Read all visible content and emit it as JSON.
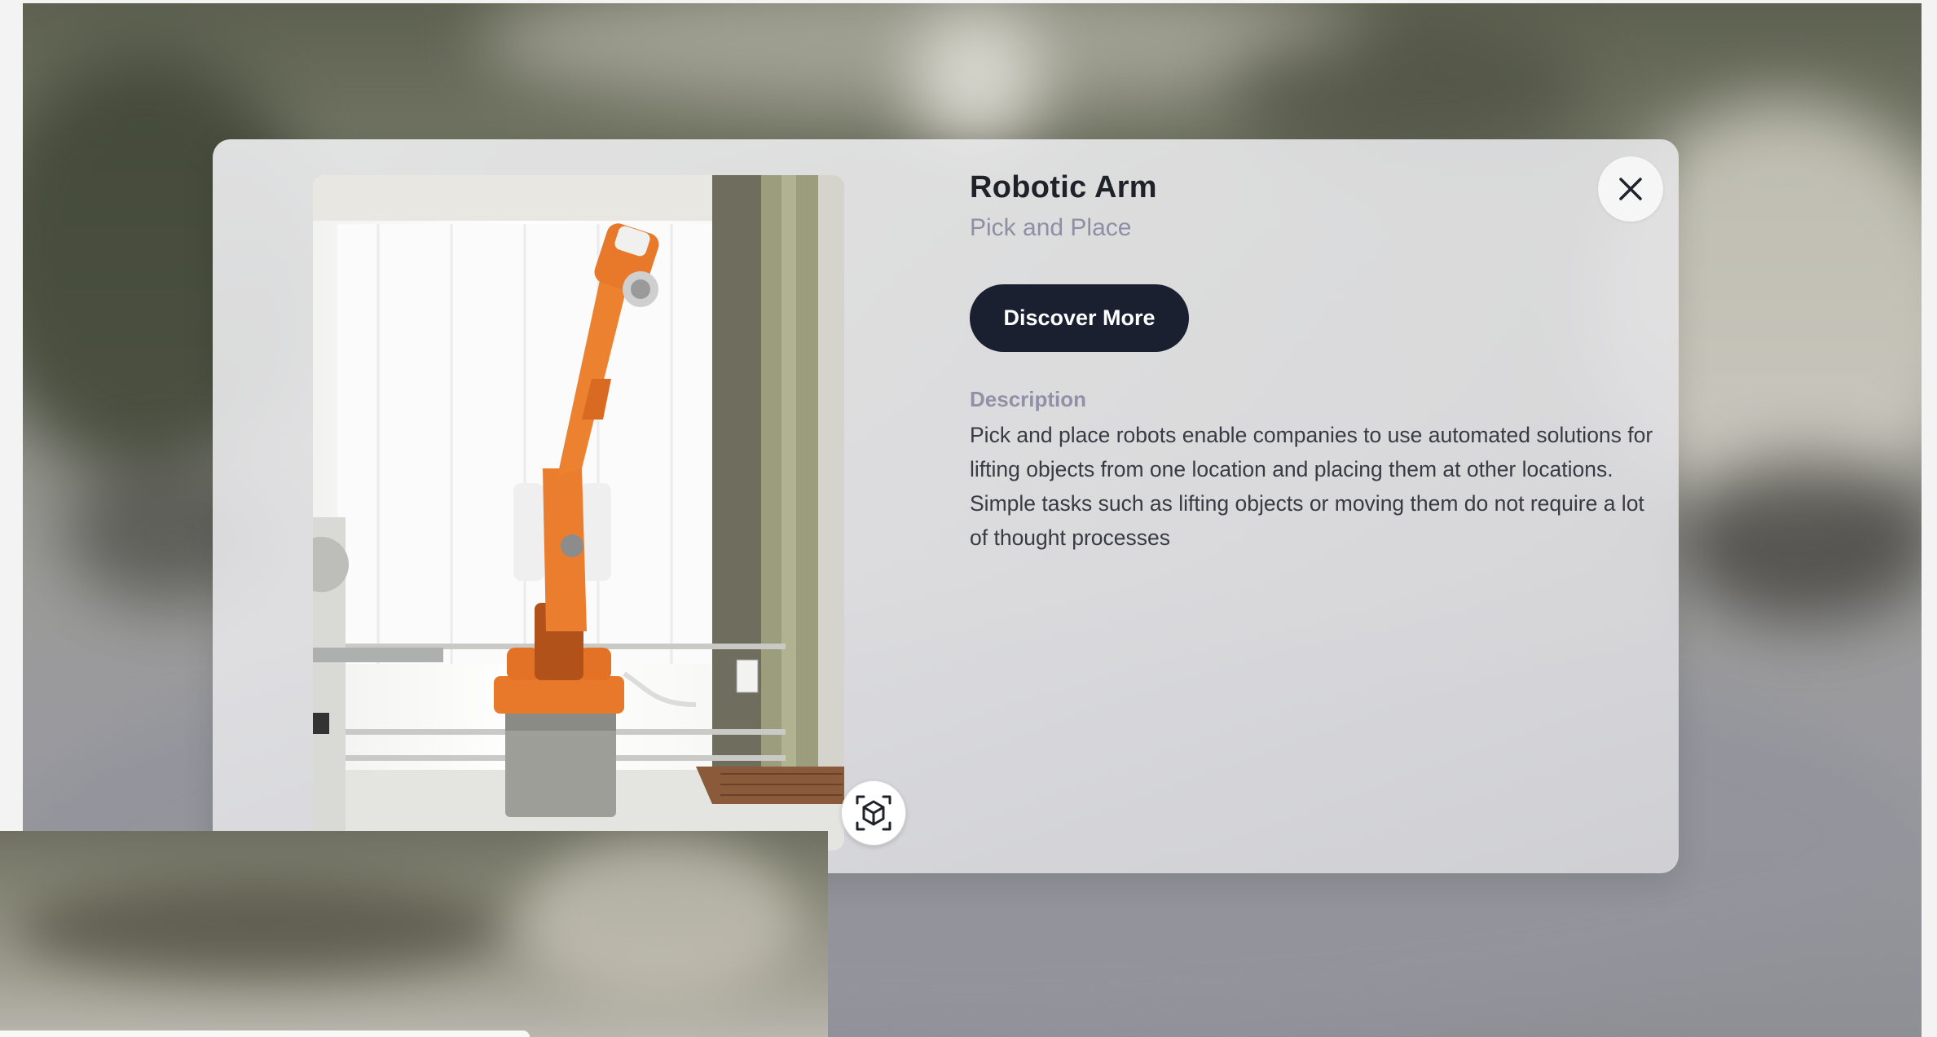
{
  "modal": {
    "title": "Robotic Arm",
    "subtitle": "Pick and Place",
    "cta_label": "Discover More",
    "description_label": "Description",
    "description": "Pick and place robots enable companies to use automated solutions for lifting objects from one location and placing them at other locations. Simple tasks such as lifting objects or moving them do not require a lot of thought processes"
  },
  "icons": {
    "close": "close-icon",
    "ar_view": "ar-cube-icon"
  },
  "colors": {
    "cta_background": "#1b2030",
    "subtitle": "#8f8ea6",
    "title": "#1f2229",
    "robot_orange": "#e8782a"
  }
}
